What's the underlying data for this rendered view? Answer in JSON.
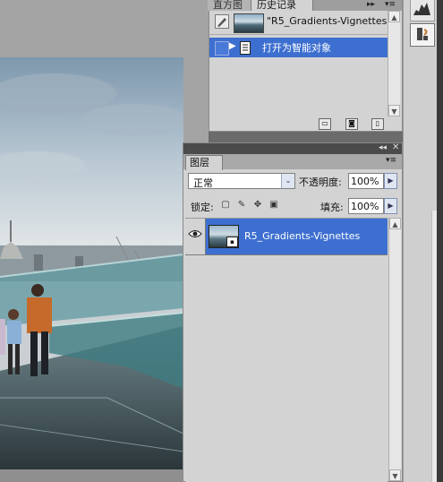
{
  "history_panel": {
    "tabs": [
      {
        "label": "直方图"
      },
      {
        "label": "历史记录"
      }
    ],
    "collapse_glyph": "▸▸",
    "menu_glyph": "▾≡",
    "snapshot": {
      "name": "\"R5_Gradients-Vignettes...",
      "icon": "brush-icon"
    },
    "states": [
      {
        "label": "打开为智能对象",
        "icon": "document-icon",
        "selected": true
      }
    ],
    "footer_buttons": [
      {
        "icon": "new-document-from-state-icon"
      },
      {
        "icon": "camera-snapshot-icon"
      },
      {
        "icon": "trash-icon"
      }
    ]
  },
  "layers_panel": {
    "tab_label": "图层",
    "titlebar": {
      "double_arrow": "◂◂",
      "close": "✕"
    },
    "menu_glyph": "▾≡",
    "blend_mode": {
      "value": "正常",
      "arrow": "⌄"
    },
    "opacity": {
      "label": "不透明度:",
      "value": "100%"
    },
    "lock": {
      "label": "锁定:",
      "icons": [
        "lock-transparency-icon",
        "lock-image-icon",
        "lock-position-icon",
        "lock-all-icon"
      ]
    },
    "fill": {
      "label": "填充:",
      "value": "100%"
    },
    "layers": [
      {
        "name": "R5_Gradients-Vignettes",
        "visible": true,
        "smart_object": true,
        "selected": true
      }
    ]
  },
  "dock": {
    "buttons": [
      {
        "icon": "histogram-icon"
      },
      {
        "icon": "history-icon",
        "active": true
      }
    ]
  },
  "colors": {
    "selection": "#3d6fd0",
    "panel_bg": "#d3d3d3",
    "titlebar": "#4b4b4b"
  }
}
